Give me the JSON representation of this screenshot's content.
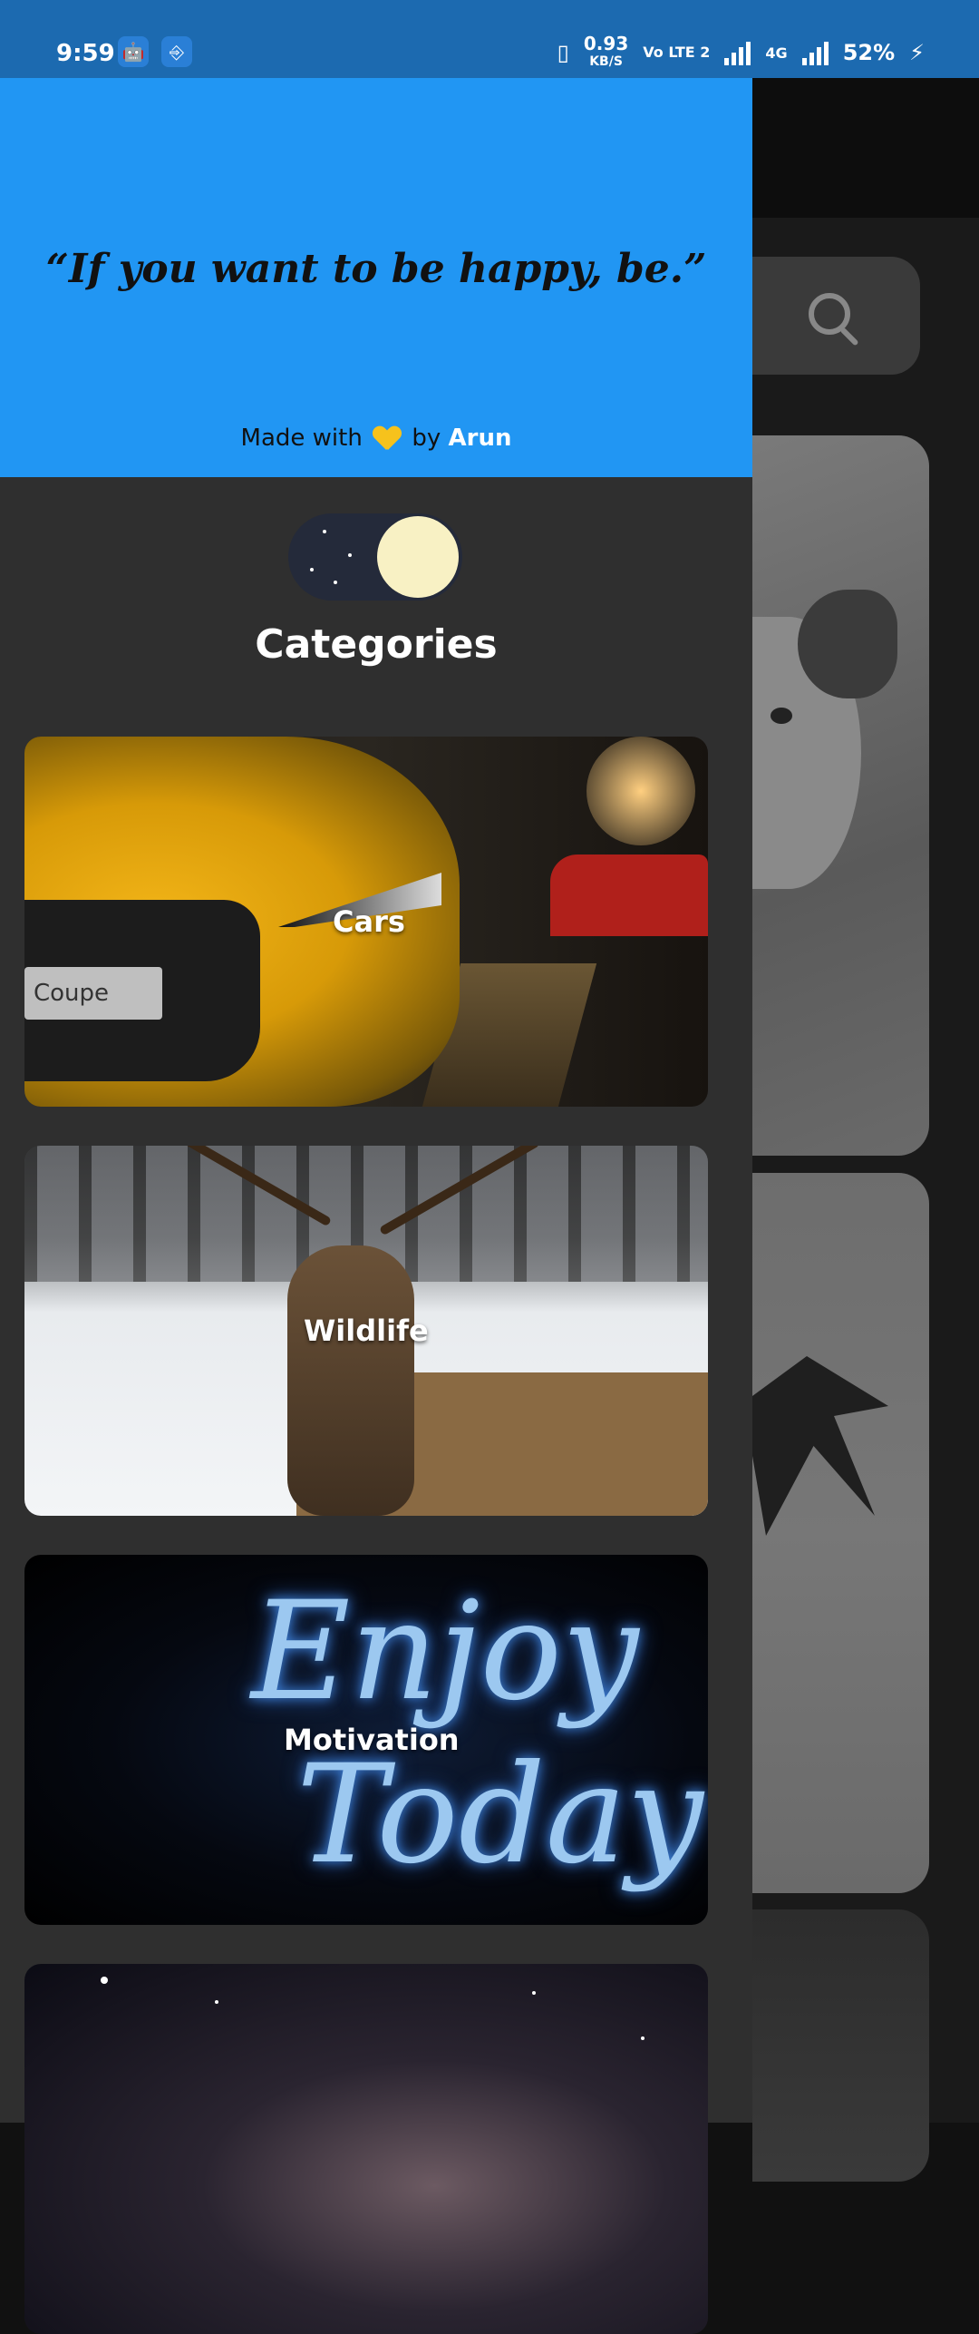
{
  "status_bar": {
    "time": "9:59",
    "speed_value": "0.93",
    "speed_unit": "KB/S",
    "volte": "Vo LTE 2",
    "network": "4G",
    "battery": "52%"
  },
  "drawer": {
    "quote": "“If you want to be happy, be.”",
    "made_with_prefix": "Made with",
    "made_with_by": "by",
    "author": "Arun",
    "theme_toggle_state": "dark",
    "categories_title": "Categories",
    "categories": [
      {
        "label": "Cars"
      },
      {
        "label": "Wildlife"
      },
      {
        "label": "Motivation"
      },
      {
        "label": ""
      }
    ],
    "car_plate_text": "Coupe",
    "neon_line1": "Enjoy",
    "neon_line2": "Today"
  },
  "colors": {
    "header_bg": "#2196f3",
    "drawer_bg": "#2f2f2f",
    "status_bar_bg": "#1c6ab0",
    "heart": "#f6c21c"
  }
}
